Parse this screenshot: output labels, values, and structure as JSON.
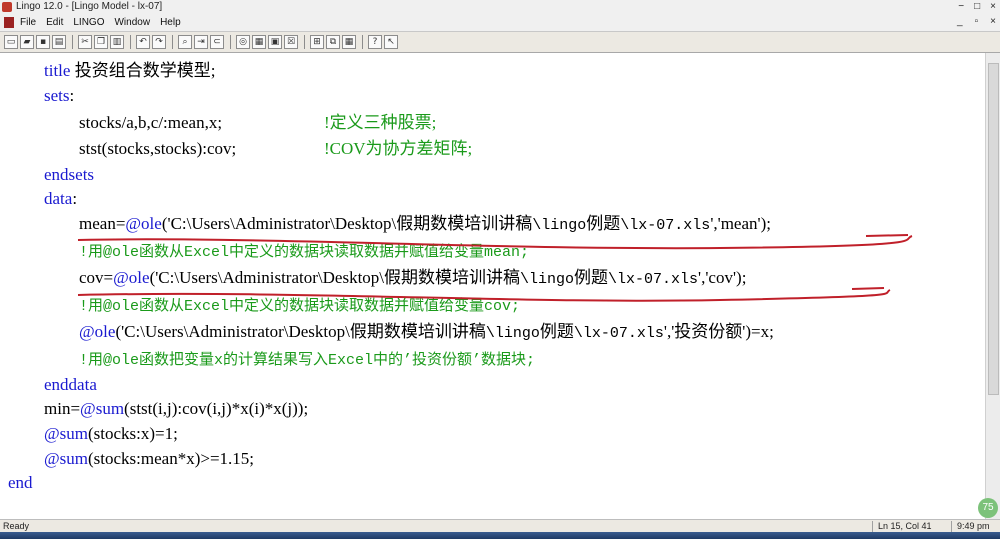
{
  "window": {
    "title": "Lingo 12.0 - [Lingo Model - lx-07]",
    "controls": [
      "−",
      "□",
      "×"
    ]
  },
  "menubar": {
    "items": [
      "File",
      "Edit",
      "LINGO",
      "Window",
      "Help"
    ],
    "mdi_controls": [
      "_",
      "▫",
      "×"
    ]
  },
  "toolbar": {
    "buttons": [
      "new-icon",
      "open-icon",
      "save-icon",
      "print-icon",
      "cut-icon",
      "copy-icon",
      "paste-icon",
      "undo-icon",
      "redo-icon",
      "find-icon",
      "goto-icon",
      "match-paren-icon",
      "solve-icon",
      "solution-icon",
      "matrix-icon",
      "options-icon",
      "close-icon",
      "tile-icon",
      "cascade-icon",
      "help-icon",
      "context-help-icon"
    ]
  },
  "code": {
    "l1": {
      "kw": "title",
      "rest": " 投资组合数学模型;"
    },
    "l2": {
      "kw": "sets",
      "rest": ":"
    },
    "l3": {
      "code": "stocks/a,b,c/:mean,x;",
      "comment": "!定义三种股票;"
    },
    "l4": {
      "code": "stst(stocks,stocks):cov;",
      "comment": "!COV为协方差矩阵;"
    },
    "l5": {
      "kw": "endsets"
    },
    "l6": {
      "kw": "data",
      "rest": ":"
    },
    "l7": {
      "a": "mean=",
      "b": "@ole",
      "c": "('C:\\Users\\Administrator\\Desktop\\",
      "d": "假期数模培训讲稿",
      "e": "\\lingo",
      "f": "例题",
      "g": "\\lx-07.xls",
      "h": "','mean');"
    },
    "l8": {
      "comment": "!用@ole函数从Excel中定义的数据块读取数据并赋值给变量mean;"
    },
    "l9": {
      "a": "cov=",
      "b": "@ole",
      "c": "('C:\\Users\\Administrator\\Desktop\\",
      "d": "假期数模培训讲稿",
      "e": "\\lingo",
      "f": "例题",
      "g": "\\lx-07.xls",
      "h": "','cov');"
    },
    "l10": {
      "comment": "!用@ole函数从Excel中定义的数据块读取数据并赋值给变量cov;"
    },
    "l11": {
      "b": "@ole",
      "c": "('C:\\Users\\Administrator\\Desktop\\",
      "d": "假期数模培训讲稿",
      "e": "\\lingo",
      "f": "例题",
      "g": "\\lx-07.xls",
      "h": "','投资份额')=x;"
    },
    "l12": {
      "comment": "!用@ole函数把变量x的计算结果写入Excel中的’投资份额’数据块;"
    },
    "l13": {
      "kw": "enddata"
    },
    "l14": {
      "a": "min=",
      "b": "@sum",
      "c": "(stst(i,j):cov(i,j)*x(i)*x(j));"
    },
    "l15": {
      "b": "@sum",
      "c": "(stocks:x)=1;"
    },
    "l16": {
      "b": "@sum",
      "c": "(stocks:mean*x)>=1.15;"
    },
    "l17": {
      "kw": "end"
    }
  },
  "statusbar": {
    "ready": "Ready",
    "position": "Ln 15, Col 41",
    "time": "9:49 pm"
  },
  "badge": "75"
}
